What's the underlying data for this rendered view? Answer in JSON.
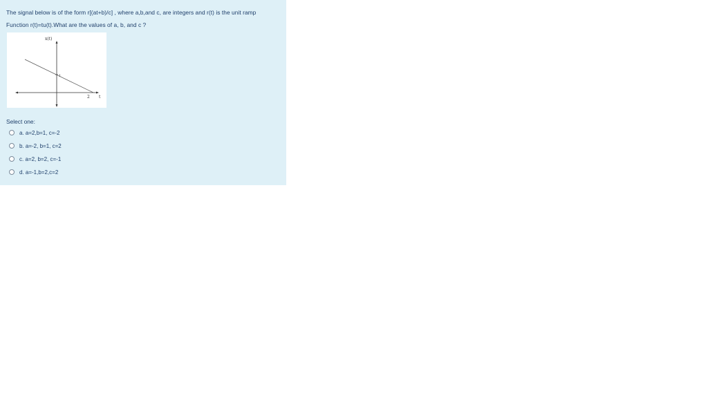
{
  "question": {
    "line1": "The signal below is of the form r[(at+b)/c] , where a,b,and c, are integers and r(t) is the unit ramp",
    "line2": "Function r(t)=tu(t).What are the values of a, b, and c ?"
  },
  "figure": {
    "y_label": "x(t)",
    "point_label": "1",
    "x_tick": "2",
    "x_axis_label": "t"
  },
  "select_label": "Select one:",
  "options": [
    {
      "label": "a. a=2,b=1, c=-2",
      "selected": false
    },
    {
      "label": "b. a=-2, b=1, c=2",
      "selected": false
    },
    {
      "label": "c. a=2, b=2, c=-1",
      "selected": false
    },
    {
      "label": "d. a=-1,b=2,c=2",
      "selected": false
    }
  ],
  "colors": {
    "card_background": "#def0f7",
    "text": "#1f3f6b"
  }
}
